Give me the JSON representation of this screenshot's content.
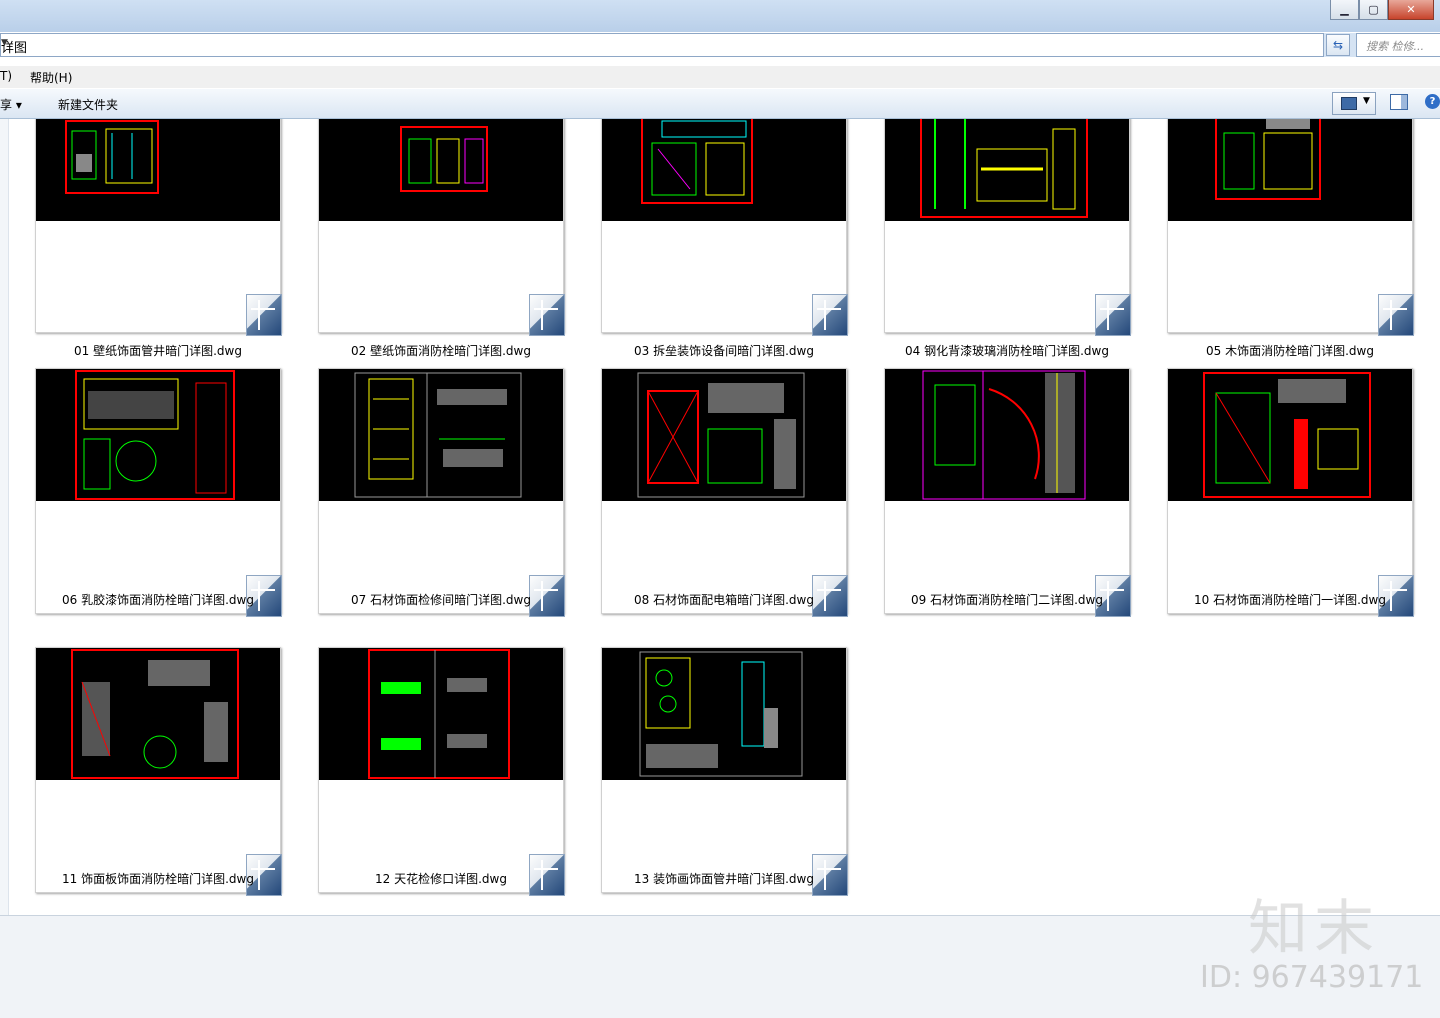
{
  "address": {
    "path": "详图"
  },
  "search": {
    "placeholder": "搜索 检修..."
  },
  "menu": {
    "tools_fragment": "T)",
    "help": "帮助(H)"
  },
  "toolbar": {
    "share": "享 ▾",
    "new_folder": "新建文件夹"
  },
  "files": [
    {
      "label": "01   壁纸饰面管井暗门详图.dwg"
    },
    {
      "label": "02   壁纸饰面消防栓暗门详图.dwg"
    },
    {
      "label": "03   拆垒装饰设备间暗门详图.dwg"
    },
    {
      "label": "04   钢化背漆玻璃消防栓暗门详图.dwg"
    },
    {
      "label": "05   木饰面消防栓暗门详图.dwg"
    },
    {
      "label": "06   乳胶漆饰面消防栓暗门详图.dwg"
    },
    {
      "label": "07   石材饰面检修间暗门详图.dwg"
    },
    {
      "label": "08   石材饰面配电箱暗门详图.dwg"
    },
    {
      "label": "09   石材饰面消防栓暗门二详图.dwg"
    },
    {
      "label": "10   石材饰面消防栓暗门一详图.dwg"
    },
    {
      "label": "11   饰面板饰面消防栓暗门详图.dwg"
    },
    {
      "label": "12   天花检修口详图.dwg"
    },
    {
      "label": "13   装饰画饰面管井暗门详图.dwg"
    }
  ],
  "watermark": {
    "brand": "知末",
    "id": "ID: 967439171"
  },
  "colors": {
    "cad_bg": "#000000",
    "cad_red": "#ff0000",
    "cad_green": "#00ff00",
    "cad_yellow": "#ffff00",
    "cad_cyan": "#00ffff"
  }
}
